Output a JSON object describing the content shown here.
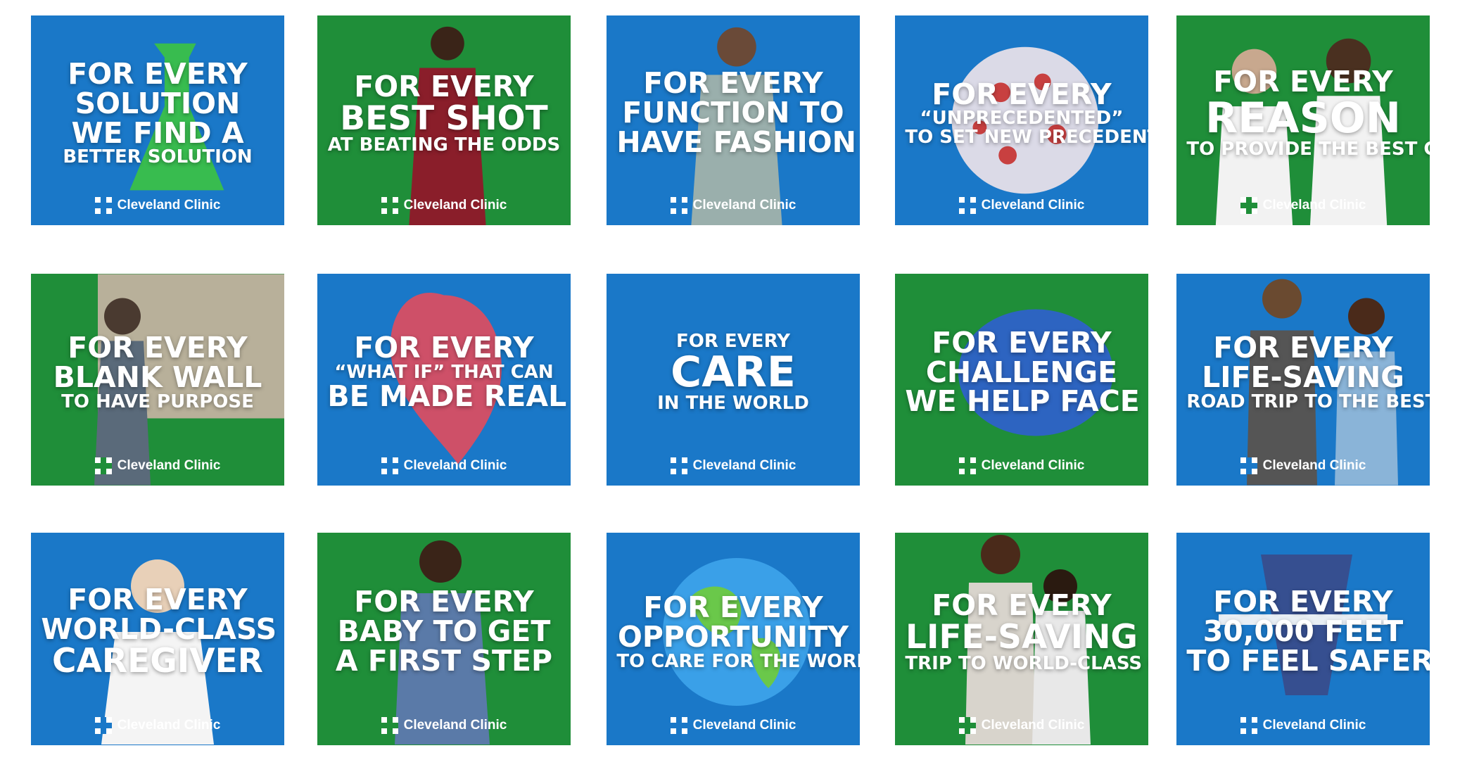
{
  "brand": {
    "name": "Cleveland Clinic",
    "blue": "#1a78c8",
    "green": "#1f8e39"
  },
  "tiles": [
    {
      "color": "blue",
      "art_icon": "flask-icon",
      "lines": [
        {
          "text": "FOR EVERY",
          "size": "m"
        },
        {
          "text": "SOLUTION",
          "size": "m"
        },
        {
          "text": "WE FIND A",
          "size": "m"
        },
        {
          "text": "BETTER SOLUTION",
          "size": "s"
        }
      ]
    },
    {
      "color": "green",
      "art_icon": "athlete-icon",
      "lines": [
        {
          "text": "FOR EVERY",
          "size": "m"
        },
        {
          "text": "BEST SHOT",
          "size": "l"
        },
        {
          "text": "AT BEATING THE ODDS",
          "size": "s"
        }
      ]
    },
    {
      "color": "blue",
      "art_icon": "patient-gown-icon",
      "lines": [
        {
          "text": "FOR EVERY",
          "size": "m"
        },
        {
          "text": "FUNCTION TO",
          "size": "m"
        },
        {
          "text": "HAVE FASHION",
          "size": "m"
        }
      ]
    },
    {
      "color": "blue",
      "art_icon": "virus-icon",
      "lines": [
        {
          "text": "FOR EVERY",
          "size": "m"
        },
        {
          "text": "“UNPRECEDENTED”",
          "size": "s"
        },
        {
          "text": "TO SET NEW PRECEDENTS",
          "size": "s"
        }
      ]
    },
    {
      "color": "green",
      "art_icon": "masked-doctors-icon",
      "lines": [
        {
          "text": "FOR EVERY",
          "size": "m"
        },
        {
          "text": "REASON",
          "size": "xl"
        },
        {
          "text": "TO PROVIDE THE BEST CARE",
          "size": "s"
        }
      ]
    },
    {
      "color": "green",
      "art_icon": "painting-icon",
      "lines": [
        {
          "text": "FOR EVERY",
          "size": "m"
        },
        {
          "text": "BLANK WALL",
          "size": "m"
        },
        {
          "text": "TO HAVE PURPOSE",
          "size": "s"
        }
      ]
    },
    {
      "color": "blue",
      "art_icon": "heart-icon",
      "lines": [
        {
          "text": "FOR EVERY",
          "size": "m"
        },
        {
          "text": "“WHAT IF” THAT CAN",
          "size": "s"
        },
        {
          "text": "BE MADE REAL",
          "size": "m"
        }
      ]
    },
    {
      "color": "blue",
      "art_icon": "",
      "lines": [
        {
          "text": "FOR EVERY",
          "size": "s"
        },
        {
          "text": "CARE",
          "size": "xl"
        },
        {
          "text": "IN THE WORLD",
          "size": "s"
        }
      ]
    },
    {
      "color": "green",
      "art_icon": "brain-icon",
      "lines": [
        {
          "text": "FOR EVERY",
          "size": "m"
        },
        {
          "text": "CHALLENGE",
          "size": "m"
        },
        {
          "text": "WE HELP FACE",
          "size": "m"
        }
      ]
    },
    {
      "color": "blue",
      "art_icon": "travelers-icon",
      "lines": [
        {
          "text": "FOR EVERY",
          "size": "m"
        },
        {
          "text": "LIFE-SAVING",
          "size": "m"
        },
        {
          "text": "ROAD TRIP TO THE BEST CARE",
          "size": "s"
        }
      ]
    },
    {
      "color": "blue",
      "art_icon": "caregiver-icon",
      "lines": [
        {
          "text": "FOR EVERY",
          "size": "m"
        },
        {
          "text": "WORLD-CLASS",
          "size": "m"
        },
        {
          "text": "CAREGIVER",
          "size": "l"
        }
      ]
    },
    {
      "color": "green",
      "art_icon": "pregnant-woman-icon",
      "lines": [
        {
          "text": "FOR EVERY",
          "size": "m"
        },
        {
          "text": "BABY TO GET",
          "size": "m"
        },
        {
          "text": "A FIRST STEP",
          "size": "m"
        }
      ]
    },
    {
      "color": "blue",
      "art_icon": "globe-icon",
      "lines": [
        {
          "text": "FOR EVERY",
          "size": "m"
        },
        {
          "text": "OPPORTUNITY",
          "size": "m"
        },
        {
          "text": "TO CARE FOR THE WORLD",
          "size": "s"
        }
      ]
    },
    {
      "color": "green",
      "art_icon": "couple-luggage-icon",
      "lines": [
        {
          "text": "FOR EVERY",
          "size": "m"
        },
        {
          "text": "LIFE-SAVING",
          "size": "l"
        },
        {
          "text": "TRIP TO WORLD-CLASS CARE",
          "size": "s"
        }
      ]
    },
    {
      "color": "blue",
      "art_icon": "airplane-hands-icon",
      "lines": [
        {
          "text": "FOR EVERY",
          "size": "m"
        },
        {
          "text": "30,000 FEET",
          "size": "m"
        },
        {
          "text": "TO FEEL SAFER",
          "size": "m"
        }
      ]
    }
  ]
}
